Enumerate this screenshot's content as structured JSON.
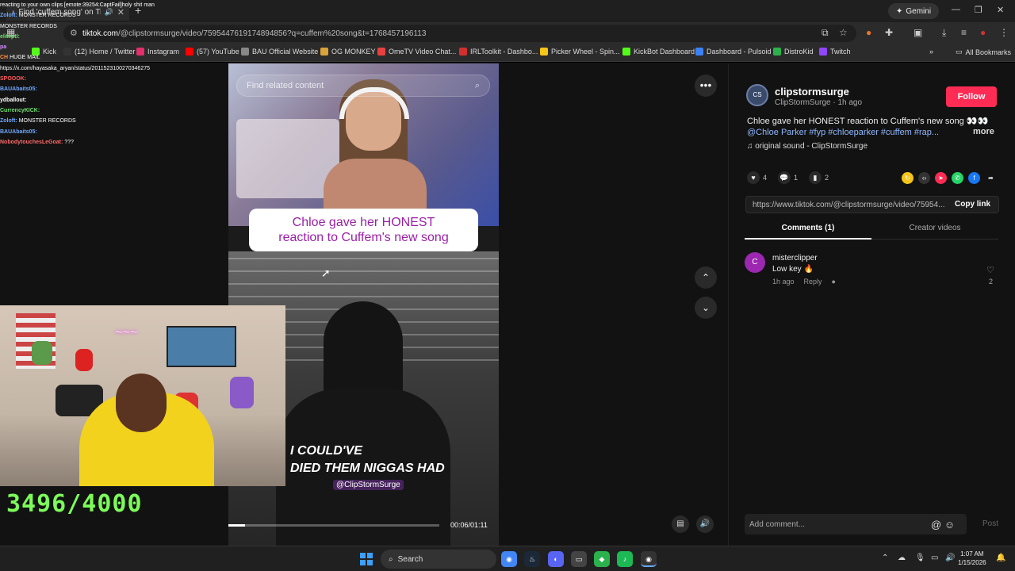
{
  "browser": {
    "tab_title": "Find 'cuffem song' on TikTo",
    "gemini_label": "Gemini",
    "url_host": "tiktok.com",
    "url_path": "/@clipstormsurge/video/7595447619174894856?q=cuffem%20song&t=1768457196113",
    "bookmarks": [
      {
        "label": "Kick",
        "color": "#53fc18"
      },
      {
        "label": "(12) Home / Twitter",
        "color": "#333"
      },
      {
        "label": "Instagram",
        "color": "#e1306c"
      },
      {
        "label": "(57) YouTube",
        "color": "#ff0000"
      },
      {
        "label": "BAU Official Website",
        "color": "#888"
      },
      {
        "label": "OG MONKEY",
        "color": "#d9a23a"
      },
      {
        "label": "OmeTV Video Chat...",
        "color": "#e84040"
      },
      {
        "label": "IRLToolkit - Dashbo...",
        "color": "#d32f2f"
      },
      {
        "label": "Picker Wheel - Spin...",
        "color": "#f5c518"
      },
      {
        "label": "KickBot Dashboard",
        "color": "#53fc18"
      },
      {
        "label": "Dashboard - Pulsoid",
        "color": "#3b82f6"
      },
      {
        "label": "DistroKid",
        "color": "#2bb24c"
      },
      {
        "label": "Twitch",
        "color": "#9146ff"
      }
    ],
    "all_bookmarks": "All Bookmarks"
  },
  "chat": {
    "messages": [
      {
        "user": "",
        "text": "reacting to your own clips [emote:39254:CaptFail]holy shit man",
        "color": "#ffcc66"
      },
      {
        "user": "",
        "text": "",
        "color": "#fff"
      },
      {
        "user": "Zoloft:",
        "text": "MONSTER RECORDS",
        "color": "#6fa8ff"
      },
      {
        "user": "",
        "text": "",
        "color": "#fff"
      },
      {
        "user": "",
        "text": "",
        "color": "#fff"
      },
      {
        "user": "",
        "text": "MONSTER RECORDS",
        "color": "#6fa8ff"
      },
      {
        "user": "eliteptl:",
        "text": "",
        "color": "#6fe06f"
      },
      {
        "user": "pa",
        "text": "",
        "color": "#d98cff"
      },
      {
        "user": "CH",
        "text": "HUGE MAIL",
        "color": "#ff8c3a"
      },
      {
        "user": "",
        "text": "https://x.com/hayasaka_aryan/status/2011523100270346275",
        "color": "#fff"
      },
      {
        "user": "SPOOOK:",
        "text": "",
        "color": "#ff5a5a"
      },
      {
        "user": "BAUAbaits05:",
        "text": "",
        "color": "#6fa8ff"
      },
      {
        "user": "ydballout:",
        "text": "",
        "color": "#fff"
      },
      {
        "user": "CurrencyKICK:",
        "text": "",
        "color": "#6fe06f"
      },
      {
        "user": "Zoloft:",
        "text": "MONSTER RECORDS",
        "color": "#6fa8ff"
      },
      {
        "user": "BAUAbaits05:",
        "text": "",
        "color": "#6fa8ff"
      },
      {
        "user": "NobodytouchesLeGoat:",
        "text": "???",
        "color": "#ff6a6a"
      }
    ]
  },
  "goal": {
    "text": "3496/4000"
  },
  "video": {
    "search_placeholder": "Find related content",
    "caption_line1": "Chloe gave her HONEST",
    "caption_line2": "reaction to Cuffem's new song",
    "lyric_line1": "I COULD'VE",
    "lyric_line2": "DIED THEM NIGGAS HAD",
    "handle": "@ClipStormSurge",
    "timecode": "00:06/01:11",
    "progress": 0.08
  },
  "post": {
    "username": "clipstormsurge",
    "meta": "ClipStormSurge · 1h ago",
    "follow_label": "Follow",
    "description": "Chloe gave her HONEST reaction to Cuffem's new song 👀👀",
    "tags": "@Chloe Parker #fyp #chloeparker #cuffem #rap...",
    "more": "more",
    "sound": "original sound - ClipStormSurge",
    "likes": "4",
    "comments": "1",
    "saves": "2",
    "link": "https://www.tiktok.com/@clipstormsurge/video/75954...",
    "copy_link": "Copy link",
    "tab_comments": "Comments (1)",
    "tab_creator": "Creator videos",
    "comment": {
      "avatar_letter": "C",
      "user": "misterclipper",
      "text": "Low key 🔥",
      "time": "1h ago",
      "reply": "Reply",
      "likes": "2"
    },
    "add_comment_placeholder": "Add comment...",
    "post_label": "Post"
  },
  "taskbar": {
    "search_label": "Search",
    "time": "1:07 AM",
    "date": "1/15/2026"
  }
}
